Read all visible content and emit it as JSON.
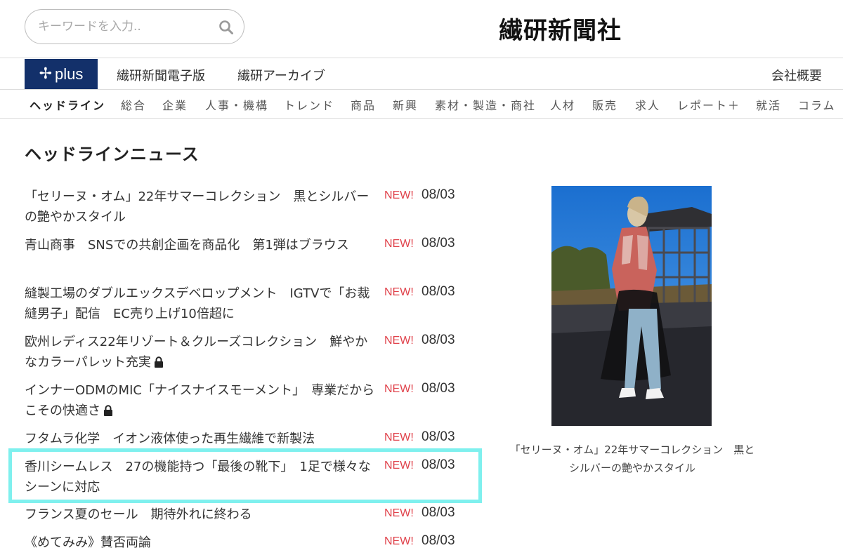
{
  "header": {
    "search_placeholder": "キーワードを入力..",
    "logo": "繊研新聞社"
  },
  "service_bar": {
    "plus_label": "plus",
    "links": [
      "繊研新聞電子版",
      "繊研アーカイブ"
    ],
    "company": "会社概要"
  },
  "category_nav": {
    "items": [
      "ヘッドライン",
      "総合",
      "企業",
      "人事・機構",
      "トレンド",
      "商品",
      "新興",
      "素材・製造・商社",
      "人材",
      "販売",
      "求人",
      "レポート＋",
      "就活",
      "コラム"
    ],
    "active": "ヘッドライン"
  },
  "section_title": "ヘッドラインニュース",
  "news": [
    {
      "title": "「セリーヌ・オム」22年サマーコレクション　黒とシルバーの艶やかスタイル",
      "badge": "NEW!",
      "date": "08/03",
      "locked": false
    },
    {
      "title": "青山商事　SNSでの共創企画を商品化　第1弾はブラウス",
      "badge": "NEW!",
      "date": "08/03",
      "locked": false
    },
    {
      "title": "縫製工場のダブルエックスデベロップメント　IGTVで「お裁縫男子」配信　EC売り上げ10倍超に",
      "badge": "NEW!",
      "date": "08/03",
      "locked": false
    },
    {
      "title": "欧州レディス22年リゾート＆クルーズコレクション　鮮やかなカラーパレット充実",
      "badge": "NEW!",
      "date": "08/03",
      "locked": true
    },
    {
      "title": "インナーODMのMIC「ナイスナイスモーメント」　専業だからこその快適さ",
      "badge": "NEW!",
      "date": "08/03",
      "locked": true
    },
    {
      "title": "フタムラ化学　イオン液体使った再生繊維で新製法",
      "badge": "NEW!",
      "date": "08/03",
      "locked": false
    },
    {
      "title": "香川シームレス　27の機能持つ「最後の靴下」　1足で様々なシーンに対応",
      "badge": "NEW!",
      "date": "08/03",
      "locked": false
    },
    {
      "title": "フランス夏のセール　期待外れに終わる",
      "badge": "NEW!",
      "date": "08/03",
      "locked": false
    },
    {
      "title": "《めてみみ》賛否両論",
      "badge": "NEW!",
      "date": "08/03",
      "locked": false
    }
  ],
  "featured": {
    "caption_line1": "「セリーヌ・オム」22年サマーコレクション　黒と",
    "caption_line2": "シルバーの艶やかスタイル"
  },
  "colors": {
    "plus_bg": "#13306a",
    "new_badge": "#e0424b",
    "highlight": "#7ff0ee"
  }
}
